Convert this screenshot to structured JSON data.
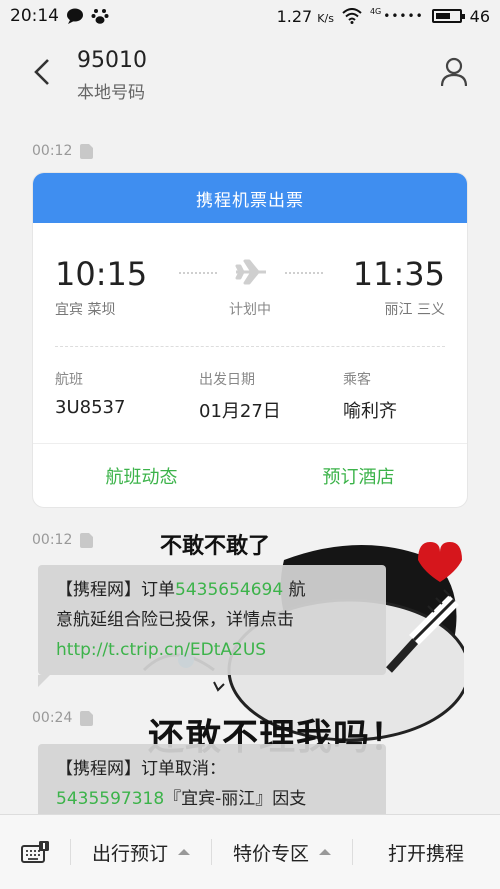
{
  "status_bar": {
    "time": "20:14",
    "speed": "1.27",
    "speed_unit": "K/s",
    "signal_dots": "•••••",
    "battery_level": "46",
    "network": "4G"
  },
  "header": {
    "title": "95010",
    "subtitle": "本地号码"
  },
  "messages": [
    {
      "time": "00:12"
    },
    {
      "time": "00:12"
    },
    {
      "time": "00:24"
    }
  ],
  "flight_card": {
    "header": "携程机票出票",
    "departure_time": "10:15",
    "departure_city": "宜宾 菜坝",
    "arrival_time": "11:35",
    "arrival_city": "丽江 三义",
    "status": "计划中",
    "flight_label": "航班",
    "flight_number": "3U8537",
    "date_label": "出发日期",
    "date_value": "01月27日",
    "passenger_label": "乘客",
    "passenger_value": "喻利齐",
    "action_flight_status": "航班动态",
    "action_book_hotel": "预订酒店"
  },
  "sticker": {
    "top_text": "不敢不敢了",
    "bottom_text": "还敢不理我吗！"
  },
  "message_1": {
    "prefix": "【携程网】订单",
    "order_number": "5435654694",
    "line1_suffix": " 航",
    "line2": "意航延组合险已投保，详情点击",
    "link": "http://t.ctrip.cn/EDtA2US"
  },
  "message_2": {
    "line1": "【携程网】订单取消：",
    "order_number": "5435597318",
    "line2_suffix": "『宜宾-丽江』因支"
  },
  "bottom_menu": {
    "item1": "出行预订",
    "item2": "特价专区",
    "item3": "打开携程"
  },
  "colors": {
    "accent_blue": "#3f8ef0",
    "link_green": "#3cb34a",
    "heart_red": "#d6161c"
  }
}
